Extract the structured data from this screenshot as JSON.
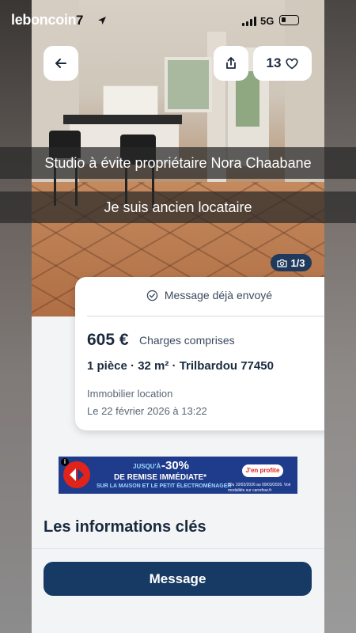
{
  "status_bar": {
    "brand": "leboncoin",
    "time": "7",
    "network": "5G"
  },
  "header": {
    "favorites_count": "13"
  },
  "captions": [
    "Studio à évite propriétaire Nora Chaabane",
    "Je suis ancien locataire"
  ],
  "photo": {
    "counter": "1/3"
  },
  "listing": {
    "sent_status": "Message déjà envoyé",
    "price": "605 €",
    "charges": "Charges comprises",
    "details": "1 pièce · 32 m² · Trilbardou 77450",
    "category": "Immobilier location",
    "date": "Le 22 février 2026 à 13:22"
  },
  "ad": {
    "small": "JUSQU'À",
    "big": "-30%",
    "main": "DE REMISE IMMÉDIATE*",
    "sub": "SUR LA MAISON ET LE PETIT ÉLECTROMÉNAGER",
    "cta": "J'en profite",
    "legal": "*Du 10/02/2026 au 09/03/2026. Voir modalités sur carrefour.fr"
  },
  "sections": {
    "key_info_title": "Les informations clés"
  },
  "actions": {
    "message_label": "Message"
  },
  "colors": {
    "primary": "#173a64",
    "badge": "#1f3a5c",
    "ad_background": "#1f3c8c",
    "ad_red": "#e2231a"
  }
}
